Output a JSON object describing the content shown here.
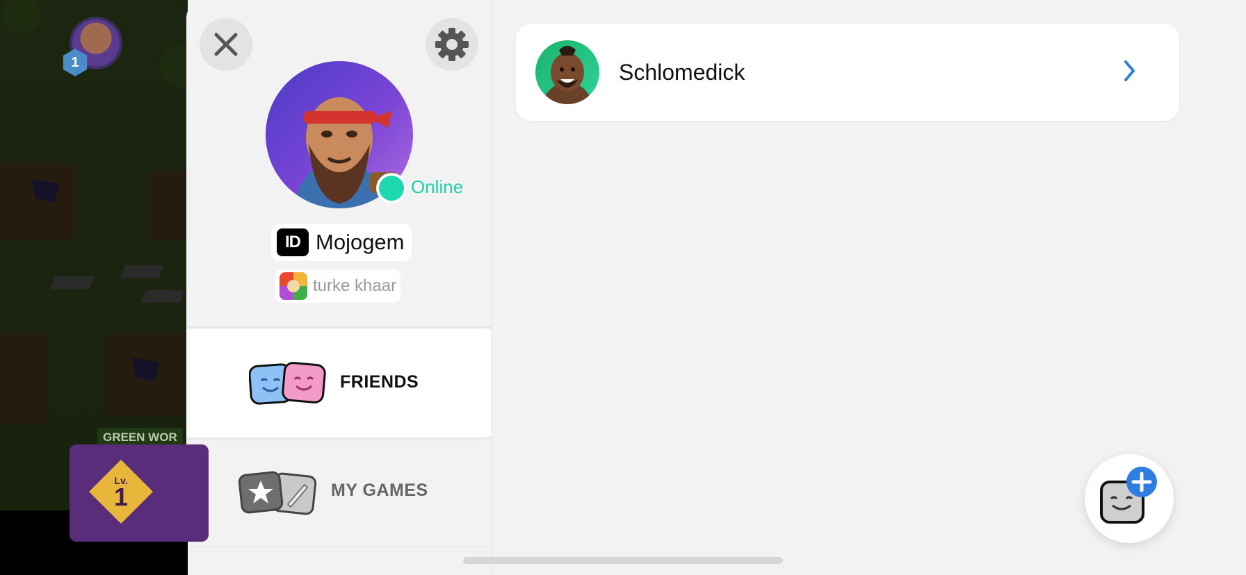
{
  "game_background": {
    "level": "1",
    "world_label": "GREEN WOR",
    "card_level_label": "Lv.",
    "card_level_number": "1"
  },
  "panel": {
    "close_icon": "close-icon",
    "settings_icon": "gear-icon",
    "status": "Online",
    "status_color": "#1ccfa9",
    "id_badge": "ID",
    "player_name": "Mojogem",
    "clan_name": "turke khaar",
    "tabs": [
      {
        "label": "FRIENDS",
        "icon": "friends-icon",
        "selected": true
      },
      {
        "label": "MY GAMES",
        "icon": "my-games-icon",
        "selected": false
      }
    ]
  },
  "friends": [
    {
      "name": "Schlomedick",
      "icon": "chevron-right-icon"
    }
  ],
  "accent_color": "#2f7de0",
  "add_friend_icon": "add-friend-icon"
}
